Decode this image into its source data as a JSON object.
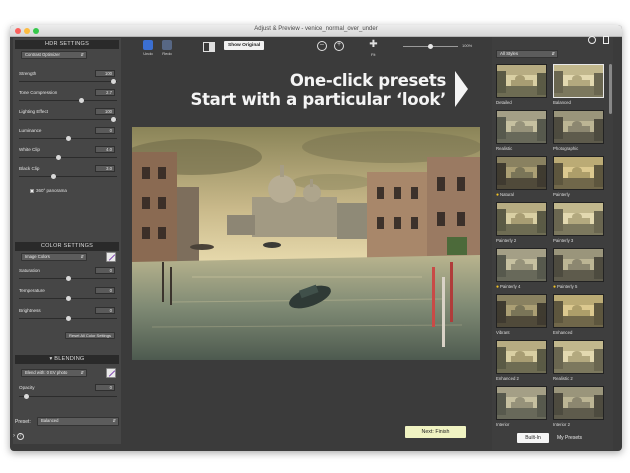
{
  "window": {
    "title": "Adjust & Preview - venice_normal_over_under"
  },
  "hdr": {
    "title": "HDR SETTINGS",
    "preset_dropdown": "Contrast Optimizer",
    "sliders": [
      {
        "label": "Strength",
        "value": "100",
        "level": 0.96
      },
      {
        "label": "Tone Compression",
        "value": "2.7",
        "level": 0.63
      },
      {
        "label": "Lighting Effect",
        "value": "100",
        "level": 0.96
      },
      {
        "label": "Luminance",
        "value": "0",
        "level": 0.5
      },
      {
        "label": "White Clip",
        "value": "4.0",
        "level": 0.4
      },
      {
        "label": "Black Clip",
        "value": "3.0",
        "level": 0.35
      }
    ],
    "panorama_label": "360° panorama"
  },
  "color": {
    "title": "COLOR SETTINGS",
    "dropdown": "Image Colors",
    "sliders": [
      {
        "label": "Saturation",
        "value": "0",
        "level": 0.5
      },
      {
        "label": "Temperature",
        "value": "0",
        "level": 0.5
      },
      {
        "label": "Brightness",
        "value": "0",
        "level": 0.5
      }
    ],
    "reset_label": "Reset All Color Settings"
  },
  "blending": {
    "title": "BLENDING",
    "dropdown": "Blend with: 0 EV photo",
    "opacity_label": "Opacity",
    "opacity_value": "0",
    "opacity_level": 0.07
  },
  "preset": {
    "label": "Preset:",
    "value": "Balanced"
  },
  "toolbar": {
    "undo": "Undo",
    "redo": "Redo",
    "show_original": "Show Original",
    "fit": "Fit",
    "zoom": "100%",
    "zoom_level": 0.45
  },
  "promo": {
    "line1": "One-click presets",
    "line2": "Start with a particular ‘look’"
  },
  "next_button": "Next: Finish",
  "styles": {
    "dropdown": "All Styles",
    "thumbnails": [
      {
        "label": "Detailed",
        "star": false
      },
      {
        "label": "Balanced",
        "star": false
      },
      {
        "label": "Realistic",
        "star": false
      },
      {
        "label": "Photographic",
        "star": false
      },
      {
        "label": "Natural",
        "star": true
      },
      {
        "label": "Painterly",
        "star": false
      },
      {
        "label": "Painterly 2",
        "star": false
      },
      {
        "label": "Painterly 3",
        "star": false
      },
      {
        "label": "Painterly 4",
        "star": true
      },
      {
        "label": "Painterly 5",
        "star": true
      },
      {
        "label": "Vibrant",
        "star": false
      },
      {
        "label": "Enhanced",
        "star": false
      },
      {
        "label": "Enhanced 2",
        "star": false
      },
      {
        "label": "Realistic 2",
        "star": false
      },
      {
        "label": "Interior",
        "star": false
      },
      {
        "label": "Interior 2",
        "star": false
      }
    ],
    "tabs": {
      "builtin": "Built-In",
      "mypresets": "My Presets"
    }
  },
  "colors": {
    "accent_button": "#f0f3c2",
    "star": "#f3c323",
    "panel": "#464646",
    "background": "#3b3b3b"
  }
}
